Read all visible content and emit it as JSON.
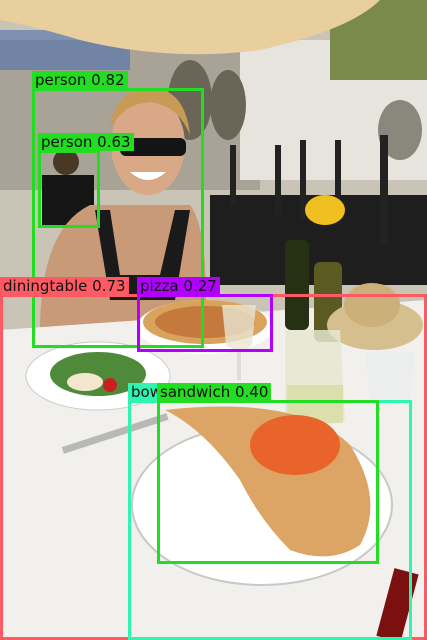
{
  "detections": [
    {
      "label": "person 0.82",
      "color": "#22dd22"
    },
    {
      "label": "person 0.63",
      "color": "#22dd22"
    },
    {
      "label": "diningtable 0.73",
      "color": "#ff5a64"
    },
    {
      "label": "pizza 0.27",
      "color": "#b200ff"
    },
    {
      "label": "bowl 0.47",
      "color": "#2ef5b0"
    },
    {
      "label": "sandwich 0.40",
      "color": "#22dd22"
    }
  ]
}
